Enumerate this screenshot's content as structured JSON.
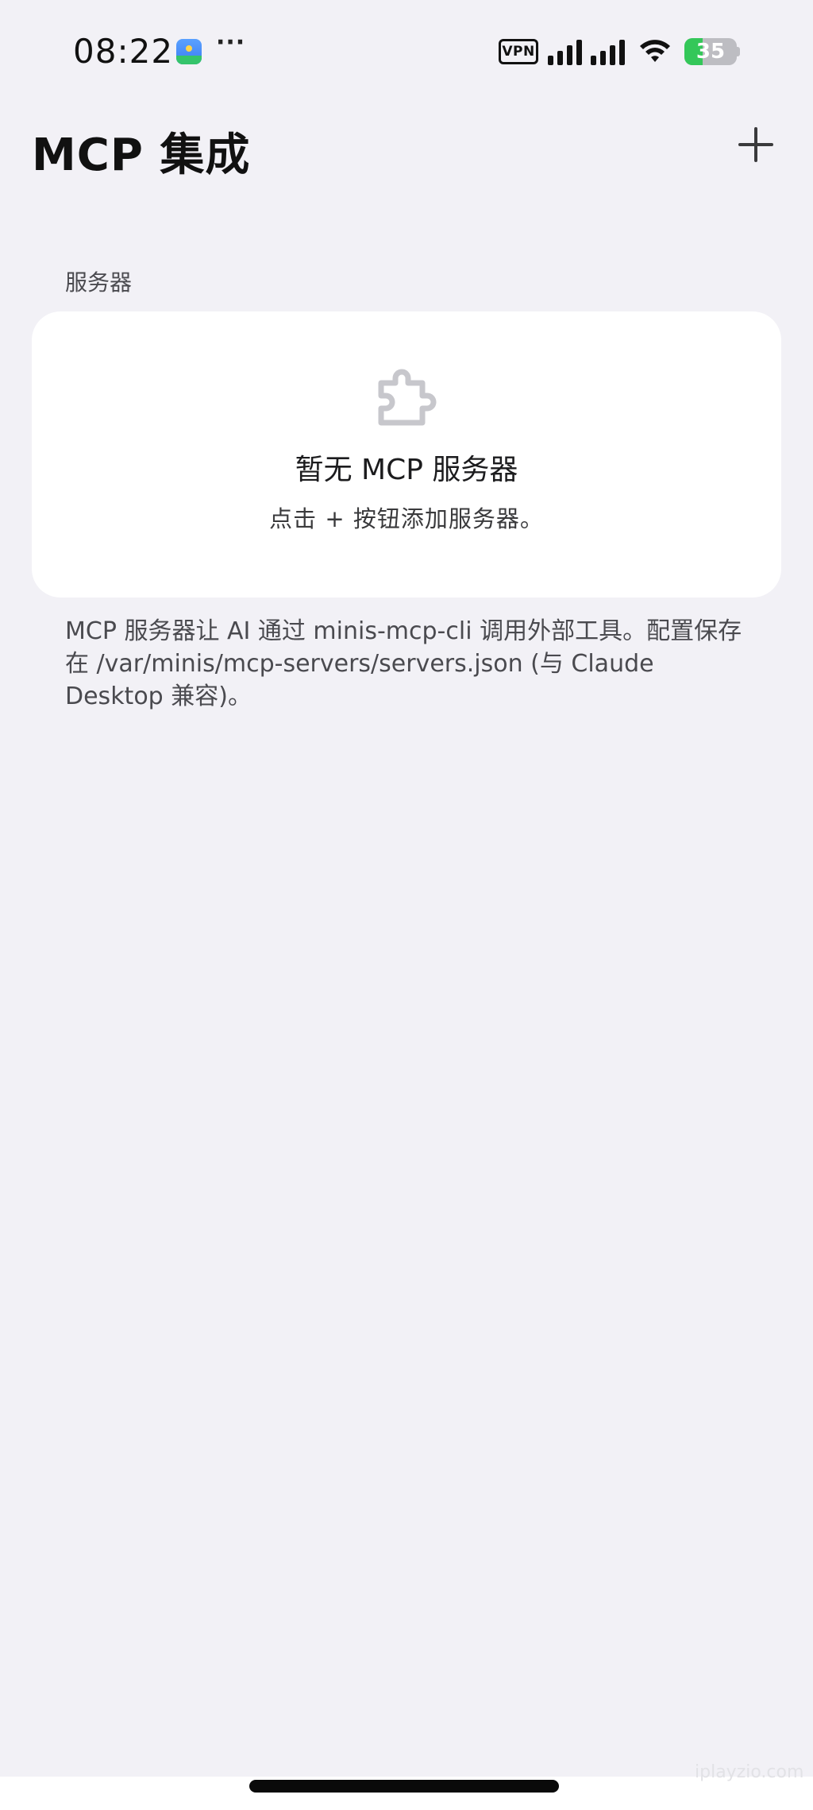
{
  "status_bar": {
    "time": "08:22",
    "more": "···",
    "vpn": "VPN",
    "battery_percent": 35,
    "battery_text": "35",
    "icons": [
      "app-notification-icon",
      "signal-icon",
      "wifi-icon",
      "battery-icon"
    ]
  },
  "header": {
    "title": "MCP 集成",
    "add_icon": "plus-icon"
  },
  "servers_section": {
    "label": "服务器",
    "empty_icon": "puzzle-icon",
    "empty_title": "暂无 MCP 服务器",
    "empty_subtitle": "点击 + 按钮添加服务器。"
  },
  "footer_note": "MCP 服务器让 AI 通过 minis-mcp-cli 调用外部工具。配置保存在 /var/minis/mcp-servers/servers.json (与 Claude Desktop 兼容)。",
  "watermark": "iplayzio.com",
  "colors": {
    "background": "#f2f1f6",
    "card": "#ffffff",
    "battery_green": "#34c759",
    "icon_gray": "#c7c7cc"
  }
}
